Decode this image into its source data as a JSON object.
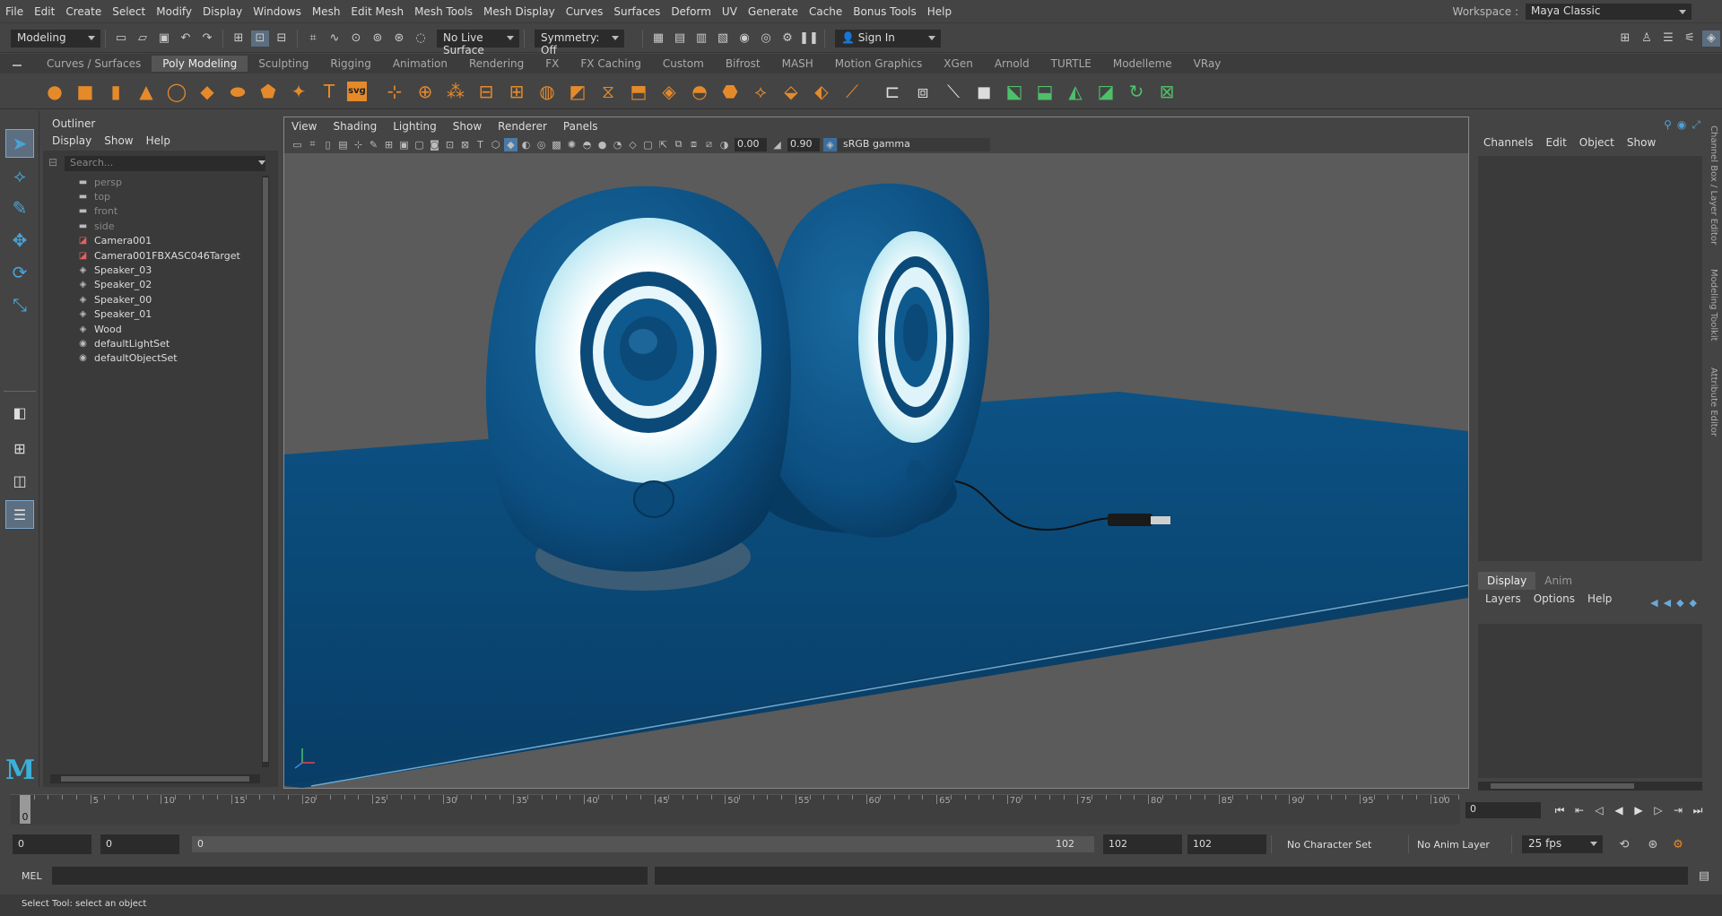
{
  "menu": [
    "File",
    "Edit",
    "Create",
    "Select",
    "Modify",
    "Display",
    "Windows",
    "Mesh",
    "Edit Mesh",
    "Mesh Tools",
    "Mesh Display",
    "Curves",
    "Surfaces",
    "Deform",
    "UV",
    "Generate",
    "Cache",
    "Bonus Tools",
    "Help"
  ],
  "workspace": {
    "label": "Workspace :",
    "value": "Maya Classic"
  },
  "status": {
    "mode": "Modeling",
    "live_surface": "No Live Surface",
    "symmetry": "Symmetry: Off",
    "sign_in": "Sign In"
  },
  "shelf_tabs": [
    "Curves / Surfaces",
    "Poly Modeling",
    "Sculpting",
    "Rigging",
    "Animation",
    "Rendering",
    "FX",
    "FX Caching",
    "Custom",
    "Bifrost",
    "MASH",
    "Motion Graphics",
    "XGen",
    "Arnold",
    "TURTLE",
    "Modelleme",
    "VRay"
  ],
  "shelf_active": "Poly Modeling",
  "shelf_icons": [
    "sphere-icon",
    "cube-icon",
    "cylinder-icon",
    "cone-icon",
    "torus-icon",
    "plane-icon",
    "disk-icon",
    "platonic-icon",
    "star-icon",
    "text-icon",
    "svg-icon",
    "pivot-icon",
    "extract-icon",
    "uv-icon",
    "combine-icon",
    "separate-icon",
    "smooth-icon",
    "mirror-icon",
    "bridge-icon",
    "extrude-icon",
    "bevel-icon",
    "fill-hole-icon",
    "bool-icon",
    "merge-icon",
    "append-icon",
    "wedge-icon",
    "multicut-icon",
    "edge-loop-icon",
    "target-weld-icon",
    "quad-draw-icon",
    "relax-icon",
    "reduce-icon",
    "cleanup-icon",
    "triangulate-icon",
    "quadrangulate-icon",
    "unfold-icon",
    "layout-icon"
  ],
  "shelf_svg_label": "svg",
  "outliner": {
    "title": "Outliner",
    "menu": [
      "Display",
      "Show",
      "Help"
    ],
    "search_placeholder": "Search...",
    "items": [
      {
        "label": "persp",
        "type": "camera",
        "dim": true
      },
      {
        "label": "top",
        "type": "camera",
        "dim": true
      },
      {
        "label": "front",
        "type": "camera",
        "dim": true
      },
      {
        "label": "side",
        "type": "camera",
        "dim": true
      },
      {
        "label": "Camera001",
        "type": "camobj",
        "dim": false
      },
      {
        "label": "Camera001FBXASC046Target",
        "type": "camobj",
        "dim": false
      },
      {
        "label": "Speaker_03",
        "type": "transform",
        "dim": false
      },
      {
        "label": "Speaker_02",
        "type": "transform",
        "dim": false
      },
      {
        "label": "Speaker_00",
        "type": "transform",
        "dim": false
      },
      {
        "label": "Speaker_01",
        "type": "transform",
        "dim": false
      },
      {
        "label": "Wood",
        "type": "transform",
        "dim": false
      },
      {
        "label": "defaultLightSet",
        "type": "set",
        "dim": false
      },
      {
        "label": "defaultObjectSet",
        "type": "set",
        "dim": false
      }
    ]
  },
  "viewport": {
    "menu": [
      "View",
      "Shading",
      "Lighting",
      "Show",
      "Renderer",
      "Panels"
    ],
    "exposure": "0.00",
    "gamma": "0.90",
    "color_space": "sRGB gamma",
    "colors": {
      "bg": "#5b5b5b",
      "speaker": "#0d4f7f",
      "speaker_dark": "#07365a",
      "cone": "#e9f7fb",
      "shelf": "#0b4a78"
    }
  },
  "channel_box": {
    "menu": [
      "Channels",
      "Edit",
      "Object",
      "Show"
    ]
  },
  "layer_editor": {
    "tabs": [
      "Display",
      "Anim"
    ],
    "active_tab": "Display",
    "menu": [
      "Layers",
      "Options",
      "Help"
    ]
  },
  "side_tabs": [
    "Channel Box / Layer Editor",
    "Modeling Toolkit",
    "Attribute Editor"
  ],
  "timeline": {
    "ticks": [
      5,
      10,
      15,
      20,
      25,
      30,
      35,
      40,
      45,
      50,
      55,
      60,
      65,
      70,
      75,
      80,
      85,
      90,
      95,
      100
    ],
    "current": "0",
    "current_frame_field": "0"
  },
  "range": {
    "start": "0",
    "anim_start": "0",
    "bar_start": "0",
    "bar_end": "102",
    "end": "102",
    "anim_end": "102",
    "character_set": "No Character Set",
    "anim_layer": "No Anim Layer",
    "fps": "25 fps"
  },
  "command": {
    "label": "MEL"
  },
  "help_line": "Select Tool: select an object"
}
